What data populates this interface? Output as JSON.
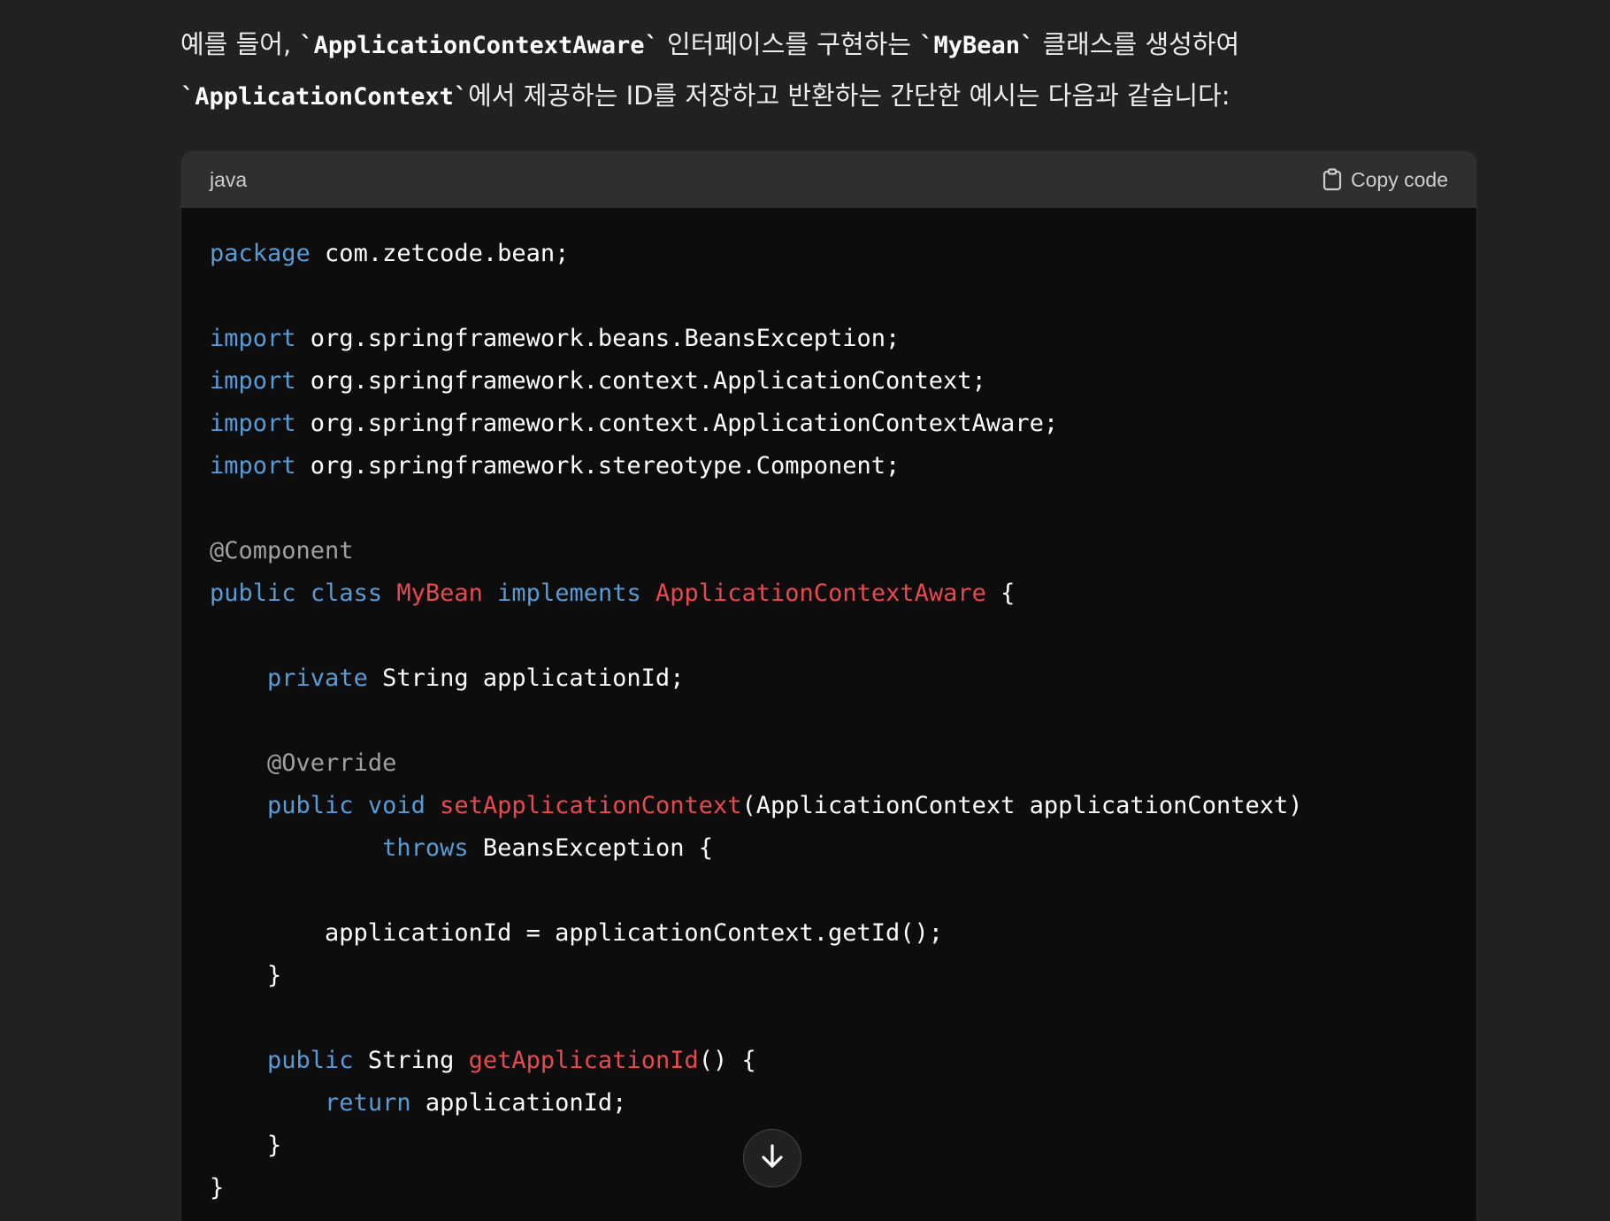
{
  "message": {
    "line1": {
      "t1": "예를 들어, ",
      "c1": "`ApplicationContextAware`",
      "t2": " 인터페이스를 구현하는 ",
      "c2": "`MyBean`",
      "t3": " 클래스를 생성하여"
    },
    "line2": {
      "c1": "`ApplicationContext`",
      "t1": "에서 제공하는 ID를 저장하고 반환하는 간단한 예시는 다음과 같습니다:"
    }
  },
  "code_block": {
    "language": "java",
    "copy_label": "Copy code",
    "copy_icon": "clipboard-icon",
    "lines": [
      [
        {
          "t": "package",
          "k": "kw"
        },
        {
          "t": " com.zetcode.bean;",
          "k": "plain"
        }
      ],
      [],
      [
        {
          "t": "import",
          "k": "kw"
        },
        {
          "t": " org.springframework.beans.BeansException;",
          "k": "plain"
        }
      ],
      [
        {
          "t": "import",
          "k": "kw"
        },
        {
          "t": " org.springframework.context.ApplicationContext;",
          "k": "plain"
        }
      ],
      [
        {
          "t": "import",
          "k": "kw"
        },
        {
          "t": " org.springframework.context.ApplicationContextAware;",
          "k": "plain"
        }
      ],
      [
        {
          "t": "import",
          "k": "kw"
        },
        {
          "t": " org.springframework.stereotype.Component;",
          "k": "plain"
        }
      ],
      [],
      [
        {
          "t": "@Component",
          "k": "ann"
        }
      ],
      [
        {
          "t": "public",
          "k": "kw"
        },
        {
          "t": " ",
          "k": "plain"
        },
        {
          "t": "class",
          "k": "kw"
        },
        {
          "t": " ",
          "k": "plain"
        },
        {
          "t": "MyBean",
          "k": "cls"
        },
        {
          "t": " ",
          "k": "plain"
        },
        {
          "t": "implements",
          "k": "kw"
        },
        {
          "t": " ",
          "k": "plain"
        },
        {
          "t": "ApplicationContextAware",
          "k": "cls"
        },
        {
          "t": " {",
          "k": "plain"
        }
      ],
      [],
      [
        {
          "t": "    ",
          "k": "plain"
        },
        {
          "t": "private",
          "k": "kw"
        },
        {
          "t": " String applicationId;",
          "k": "plain"
        }
      ],
      [],
      [
        {
          "t": "    ",
          "k": "plain"
        },
        {
          "t": "@Override",
          "k": "ann"
        }
      ],
      [
        {
          "t": "    ",
          "k": "plain"
        },
        {
          "t": "public",
          "k": "kw"
        },
        {
          "t": " ",
          "k": "plain"
        },
        {
          "t": "void",
          "k": "kw"
        },
        {
          "t": " ",
          "k": "plain"
        },
        {
          "t": "setApplicationContext",
          "k": "cls"
        },
        {
          "t": "(ApplicationContext applicationContext)",
          "k": "plain"
        }
      ],
      [
        {
          "t": "            ",
          "k": "plain"
        },
        {
          "t": "throws",
          "k": "kw"
        },
        {
          "t": " BeansException {",
          "k": "plain"
        }
      ],
      [],
      [
        {
          "t": "        applicationId = applicationContext.getId();",
          "k": "plain"
        }
      ],
      [
        {
          "t": "    }",
          "k": "plain"
        }
      ],
      [],
      [
        {
          "t": "    ",
          "k": "plain"
        },
        {
          "t": "public",
          "k": "kw"
        },
        {
          "t": " String ",
          "k": "plain"
        },
        {
          "t": "getApplicationId",
          "k": "cls"
        },
        {
          "t": "() {",
          "k": "plain"
        }
      ],
      [
        {
          "t": "        ",
          "k": "plain"
        },
        {
          "t": "return",
          "k": "kw"
        },
        {
          "t": " applicationId;",
          "k": "plain"
        }
      ],
      [
        {
          "t": "    }",
          "k": "plain"
        }
      ],
      [
        {
          "t": "}",
          "k": "plain"
        }
      ]
    ]
  },
  "scroll_button": {
    "icon": "arrow-down-icon"
  },
  "colors": {
    "background": "#212121",
    "code_background": "#0d0d0d",
    "code_header": "#2f2f2f",
    "keyword": "#569cd6",
    "class_name": "#e9484e",
    "annotation": "#a0a0a0",
    "text": "#ececec"
  }
}
